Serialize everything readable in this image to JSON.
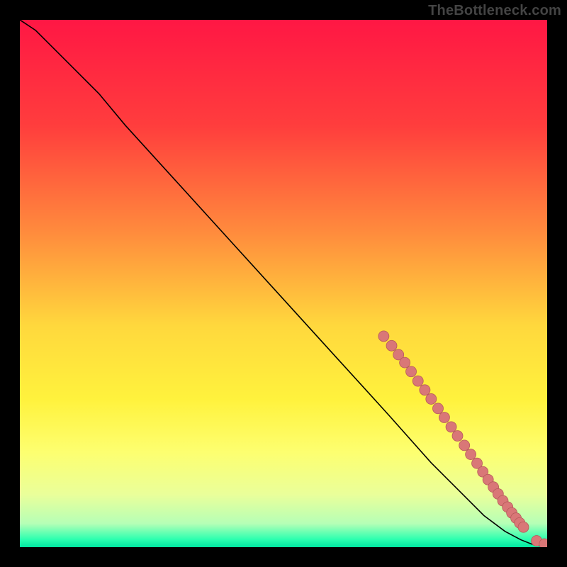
{
  "watermark": "TheBottleneck.com",
  "colors": {
    "frame": "#000000",
    "watermark": "#444444",
    "curve": "#000000",
    "marker_fill": "#d97777",
    "marker_stroke": "#b65a5a",
    "gradient_stops": [
      {
        "offset": 0.0,
        "color": "#ff1744"
      },
      {
        "offset": 0.2,
        "color": "#ff3d3d"
      },
      {
        "offset": 0.4,
        "color": "#ff8a3d"
      },
      {
        "offset": 0.58,
        "color": "#ffd83d"
      },
      {
        "offset": 0.72,
        "color": "#fff23d"
      },
      {
        "offset": 0.82,
        "color": "#fdff70"
      },
      {
        "offset": 0.9,
        "color": "#eaff9a"
      },
      {
        "offset": 0.955,
        "color": "#b6ffb6"
      },
      {
        "offset": 0.985,
        "color": "#2dffb0"
      },
      {
        "offset": 1.0,
        "color": "#00e6a0"
      }
    ]
  },
  "chart_data": {
    "type": "line",
    "title": "",
    "xlabel": "",
    "ylabel": "",
    "xlim": [
      0,
      100
    ],
    "ylim": [
      0,
      100
    ],
    "grid": false,
    "legend": false,
    "series": [
      {
        "name": "curve",
        "x": [
          0,
          3,
          6,
          10,
          15,
          20,
          30,
          40,
          50,
          60,
          70,
          78,
          84,
          88,
          92,
          95,
          97,
          98.5,
          100
        ],
        "y": [
          100,
          98,
          95,
          91,
          86,
          80,
          69,
          58,
          47,
          36,
          25,
          16,
          10,
          6,
          3,
          1.4,
          0.6,
          0.3,
          0.2
        ]
      }
    ],
    "markers": [
      {
        "x": 69.0,
        "y": 40.0
      },
      {
        "x": 70.5,
        "y": 38.2
      },
      {
        "x": 71.8,
        "y": 36.5
      },
      {
        "x": 73.0,
        "y": 35.0
      },
      {
        "x": 74.2,
        "y": 33.3
      },
      {
        "x": 75.5,
        "y": 31.5
      },
      {
        "x": 76.8,
        "y": 29.8
      },
      {
        "x": 78.0,
        "y": 28.1
      },
      {
        "x": 79.3,
        "y": 26.3
      },
      {
        "x": 80.5,
        "y": 24.6
      },
      {
        "x": 81.8,
        "y": 22.8
      },
      {
        "x": 83.0,
        "y": 21.1
      },
      {
        "x": 84.3,
        "y": 19.3
      },
      {
        "x": 85.5,
        "y": 17.6
      },
      {
        "x": 86.7,
        "y": 15.9
      },
      {
        "x": 87.8,
        "y": 14.3
      },
      {
        "x": 88.8,
        "y": 12.8
      },
      {
        "x": 89.8,
        "y": 11.4
      },
      {
        "x": 90.7,
        "y": 10.1
      },
      {
        "x": 91.6,
        "y": 8.8
      },
      {
        "x": 92.5,
        "y": 7.6
      },
      {
        "x": 93.3,
        "y": 6.5
      },
      {
        "x": 94.1,
        "y": 5.5
      },
      {
        "x": 94.8,
        "y": 4.6
      },
      {
        "x": 95.5,
        "y": 3.8
      },
      {
        "x": 98.0,
        "y": 1.2
      },
      {
        "x": 99.5,
        "y": 0.6
      }
    ]
  }
}
